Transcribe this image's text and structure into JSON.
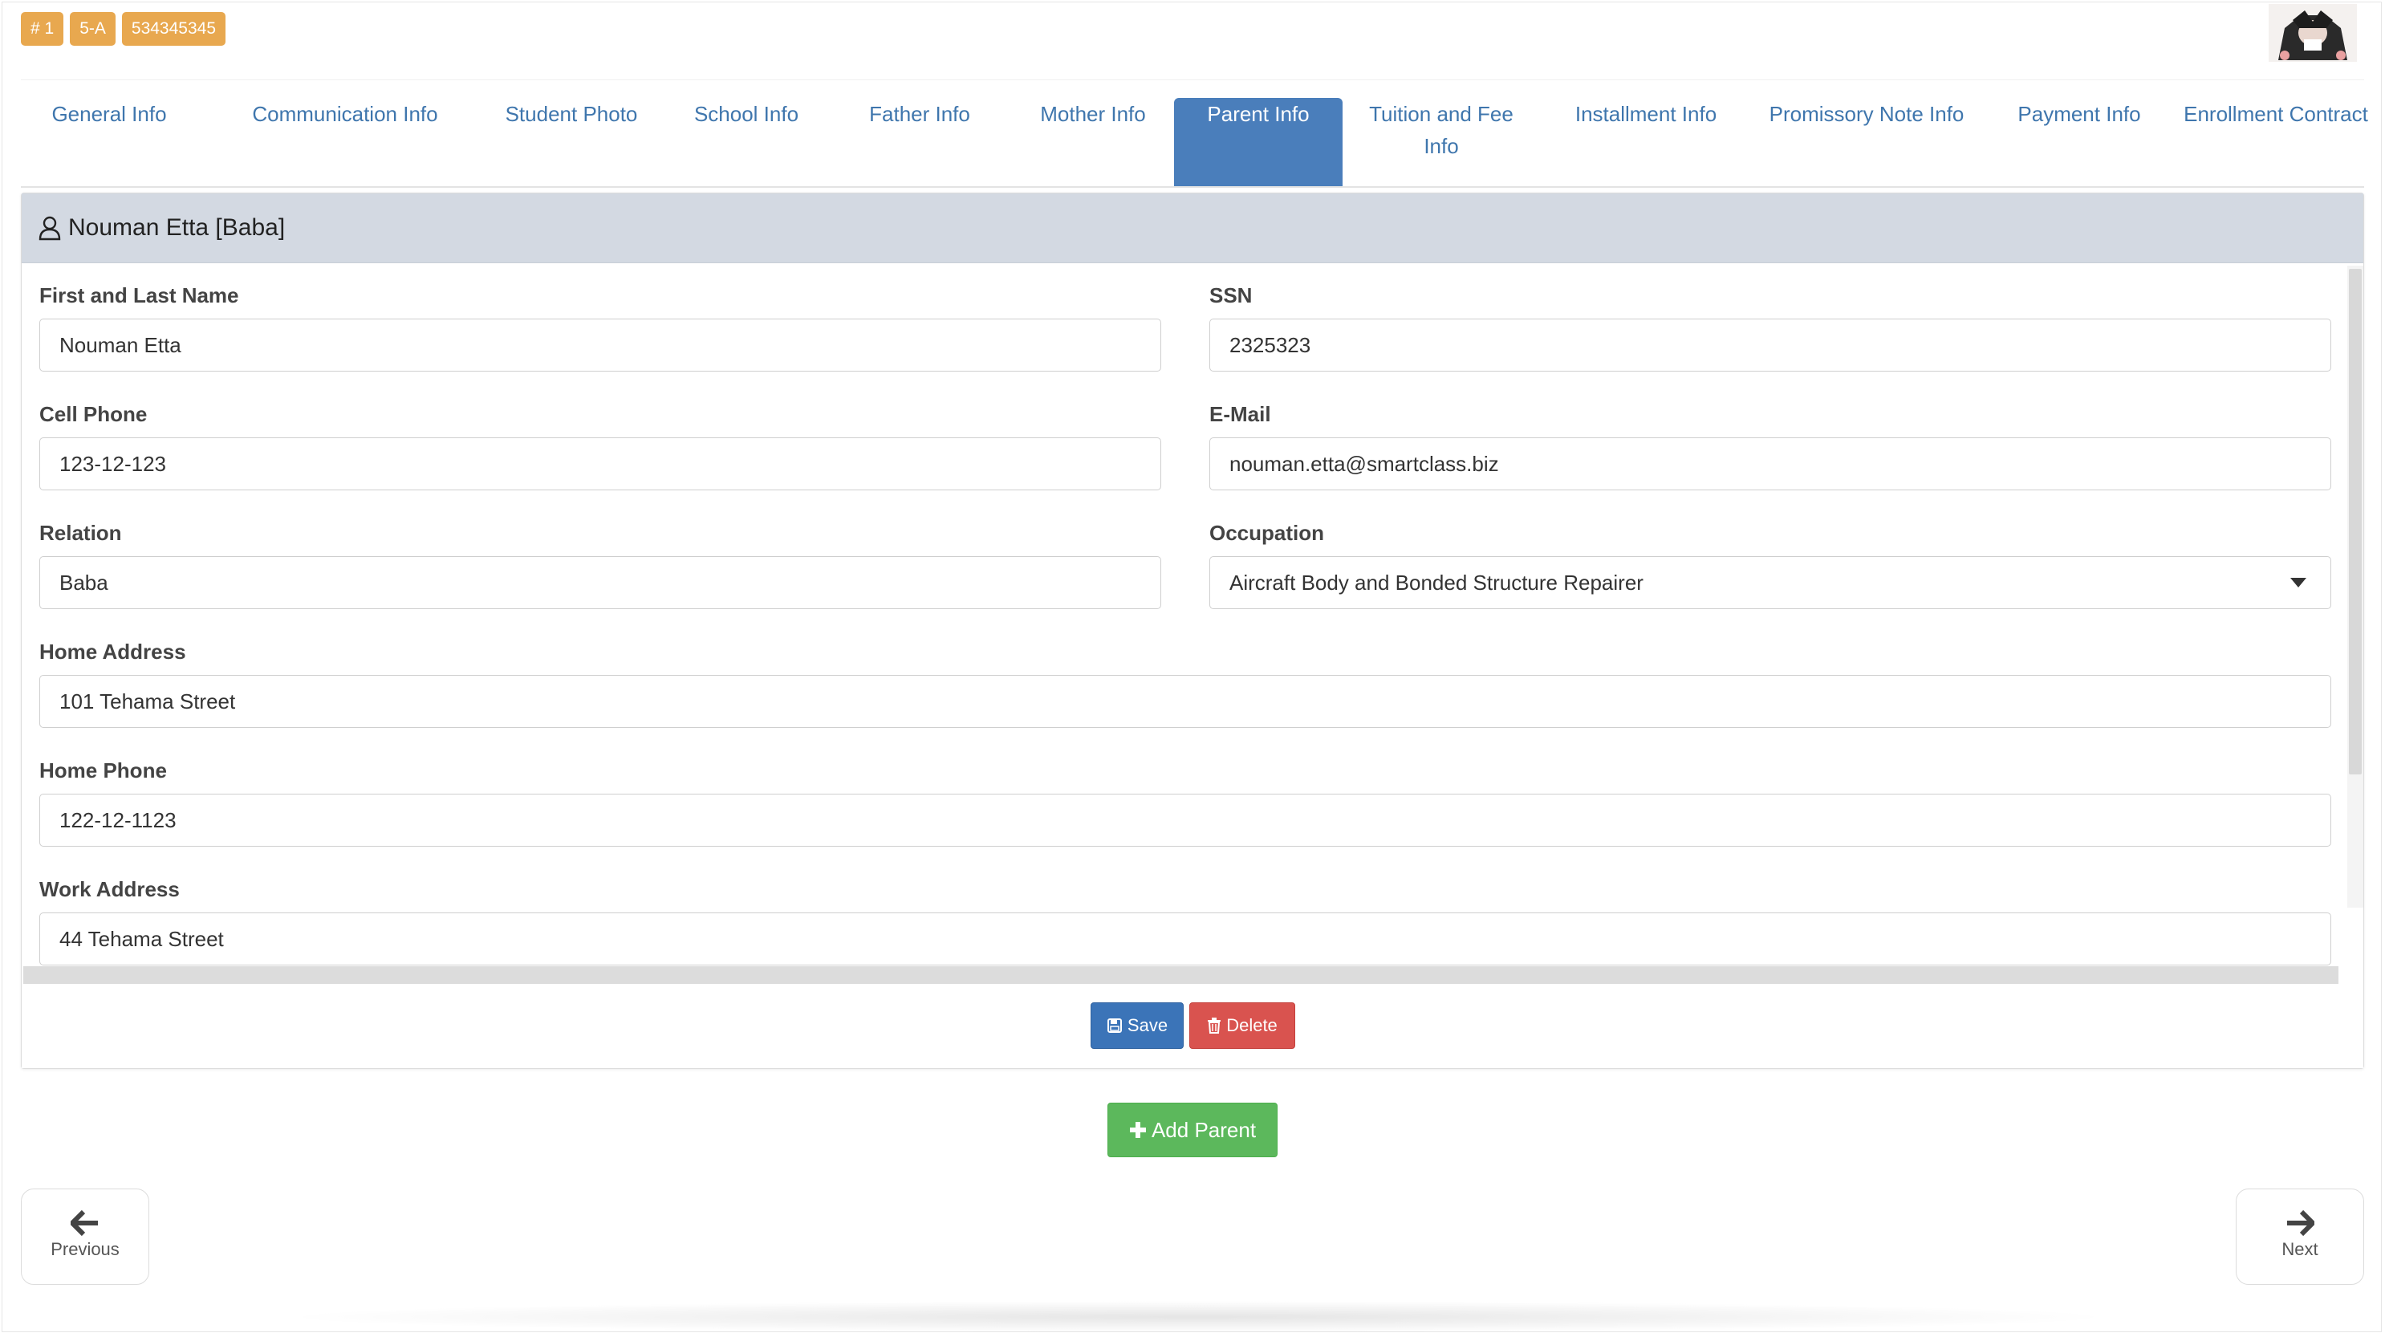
{
  "header": {
    "badges": [
      "# 1",
      "5-A",
      "534345345"
    ]
  },
  "tabs": [
    {
      "label": "General Info"
    },
    {
      "label": "Communication Info"
    },
    {
      "label": "Student Photo"
    },
    {
      "label": "School Info"
    },
    {
      "label": "Father Info"
    },
    {
      "label": "Mother Info"
    },
    {
      "label": "Parent Info"
    },
    {
      "label": "Tuition and Fee Info"
    },
    {
      "label": "Installment Info"
    },
    {
      "label": "Promissory Note Info"
    },
    {
      "label": "Payment Info"
    },
    {
      "label": "Enrollment Contract"
    }
  ],
  "panel": {
    "title": "Nouman Etta [Baba]",
    "fields": {
      "name": {
        "label": "First and Last Name",
        "value": "Nouman Etta"
      },
      "ssn": {
        "label": "SSN",
        "value": "2325323"
      },
      "cell": {
        "label": "Cell Phone",
        "value": "123-12-123"
      },
      "email": {
        "label": "E-Mail",
        "value": "nouman.etta@smartclass.biz"
      },
      "relation": {
        "label": "Relation",
        "value": "Baba"
      },
      "occupation": {
        "label": "Occupation",
        "value": "Aircraft Body and Bonded Structure Repairer"
      },
      "home_address": {
        "label": "Home Address",
        "value": "101 Tehama Street"
      },
      "home_phone": {
        "label": "Home Phone",
        "value": "122-12-1123"
      },
      "work_address": {
        "label": "Work Address",
        "value": "44 Tehama Street"
      }
    },
    "save_label": "Save",
    "delete_label": "Delete"
  },
  "add_parent_label": "Add Parent",
  "nav": {
    "previous_label": "Previous",
    "next_label": "Next"
  },
  "colors": {
    "tab_text": "#3f76ad",
    "tab_active": "#4a7ebb",
    "badge": "#e8a84f",
    "save": "#3b74b8",
    "delete": "#d9534f",
    "add": "#5cb85c"
  }
}
